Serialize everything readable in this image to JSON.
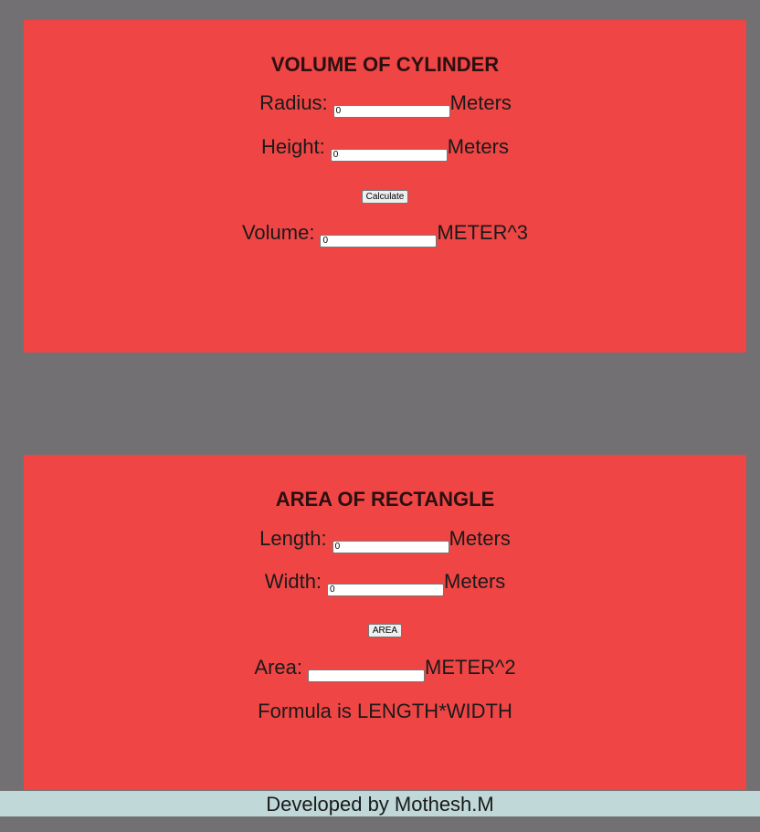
{
  "cylinder": {
    "title": "VOLUME OF CYLINDER",
    "radius_label": "Radius:",
    "radius_value": "0",
    "radius_unit": "Meters",
    "height_label": "Height:",
    "height_value": "0",
    "height_unit": "Meters",
    "calculate_label": "Calculate",
    "volume_label": "Volume:",
    "volume_value": "0",
    "volume_unit": "METER^3"
  },
  "rectangle": {
    "title": "AREA OF RECTANGLE",
    "length_label": "Length:",
    "length_value": "0",
    "length_unit": "Meters",
    "width_label": "Width:",
    "width_value": "0",
    "width_unit": "Meters",
    "area_button_label": "AREA",
    "area_label": "Area:",
    "area_value": "",
    "area_unit": "METER^2",
    "formula_text": "Formula is LENGTH*WIDTH"
  },
  "footer": {
    "text": "Developed by Mothesh.M"
  },
  "colors": {
    "page_background": "#727073",
    "panel_background": "#f04545",
    "footer_background": "#c0d8d8"
  }
}
